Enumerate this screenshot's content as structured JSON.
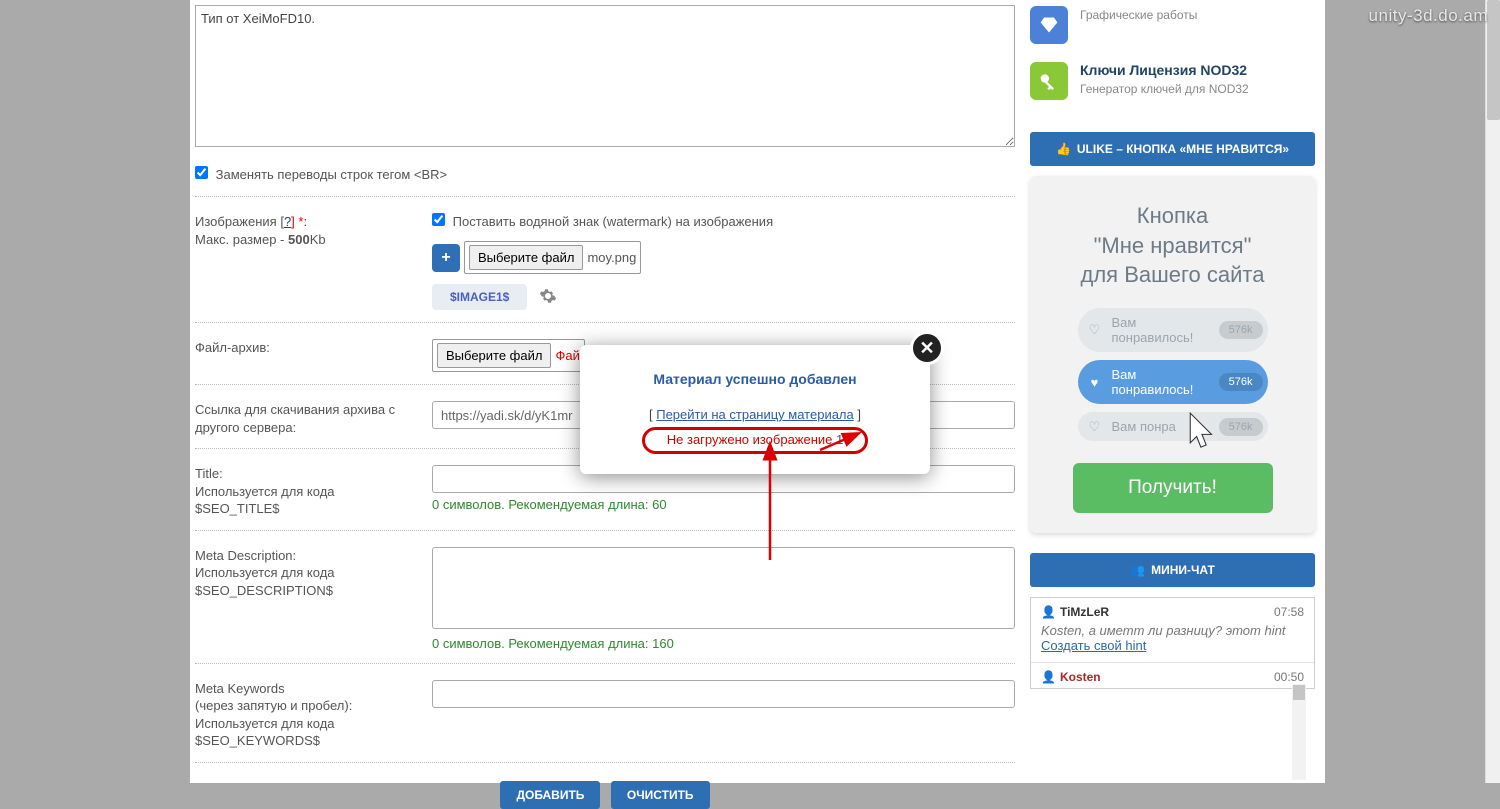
{
  "watermark": "unity-3d.do.am",
  "editor_text": "Тип от XeiMoFD10.",
  "br_checkbox_label": "Заменять переводы строк тегом <BR>",
  "images": {
    "label": "Изображения [",
    "help": "?",
    "req": "] *:",
    "max": "Макс. размер - ",
    "max_val": "500",
    "max_unit": "Kb",
    "watermark_cb": "Поставить водяной знак (watermark) на изображения",
    "choose": "Выберите файл",
    "filename": "moy.png",
    "image_tag": "$IMAGE1$"
  },
  "file_archive": {
    "label": "Файл-архив:",
    "choose": "Выберите файл",
    "status": "Фай"
  },
  "download_link": {
    "label": "Ссылка для скачивания архива с другого сервера:",
    "value": "https://yadi.sk/d/yK1mr"
  },
  "title_field": {
    "label1": "Title:",
    "label2": "Используется для кода",
    "label3": "$SEO_TITLE$",
    "hint": "0 символов. Рекомендуемая длина: 60"
  },
  "desc_field": {
    "label1": "Meta Description:",
    "label2": "Используется для кода",
    "label3": "$SEO_DESCRIPTION$",
    "hint": "0 символов. Рекомендуемая длина: 160"
  },
  "kw_field": {
    "label1": "Meta Keywords",
    "label2": "(через запятую и пробел):",
    "label3": "Используется для кода",
    "label4": "$SEO_KEYWORDS$"
  },
  "buttons": {
    "add": "ДОБАВИТЬ",
    "clear": "ОЧИСТИТЬ"
  },
  "sidebar_items": [
    {
      "subtitle": "Графические работы"
    },
    {
      "title": "Ключи Лицензия NOD32",
      "subtitle": "Генератор ключей для NOD32"
    }
  ],
  "ulike_header": "ULIKE – КНОПКА «МНЕ НРАВИТСЯ»",
  "ulike_widget": {
    "heading_l1": "Кнопка",
    "heading_l2": "\"Мне нравится\"",
    "heading_l3": "для Вашего сайта",
    "pill_text": "Вам понравилось!",
    "pill_text_short": "Вам понра",
    "badge": "576k",
    "get": "Получить!"
  },
  "minichat_header": "МИНИ-ЧАТ",
  "chat": [
    {
      "user": "TiMzLeR",
      "time": "07:58",
      "text": "Kosten, а иметт ли разницу? этот hint",
      "link": "Создать свой hint"
    },
    {
      "user": "Kosten",
      "time": "00:50"
    }
  ],
  "modal": {
    "title": "Материал успешно добавлен",
    "bracket_open": "[ ",
    "link": "Перейти на страницу материала",
    "bracket_close": " ]",
    "err_text": "Не загружено изображение ",
    "err_num": "1"
  }
}
